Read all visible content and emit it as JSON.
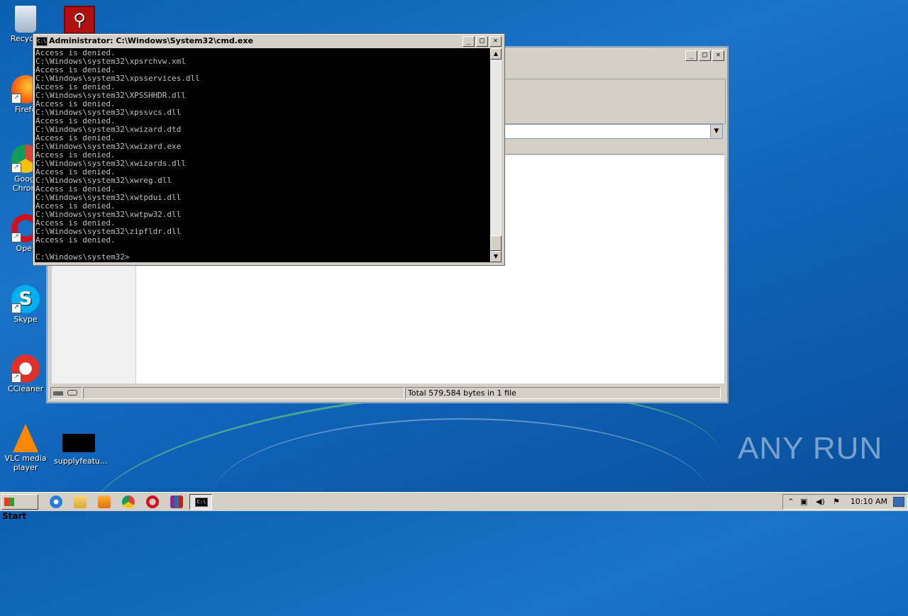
{
  "desktop": {
    "icons": [
      {
        "label": "Recycle",
        "icon": "recycle-bin-icon"
      },
      {
        "label": "Firefo",
        "icon": "firefox-icon"
      },
      {
        "label": "Googl",
        "label2": "Chrom",
        "icon": "chrome-icon"
      },
      {
        "label": "Oper",
        "icon": "opera-icon"
      },
      {
        "label": "Skype",
        "icon": "skype-icon"
      },
      {
        "label": "CCleaner",
        "icon": "ccleaner-icon"
      },
      {
        "label": "VLC media",
        "label2": "player",
        "icon": "vlc-icon"
      },
      {
        "label": "supplyfeatu...",
        "icon": "exe-file-icon"
      },
      {
        "label": "",
        "icon": "acrobat-icon"
      }
    ],
    "watermark": "ANY RUN"
  },
  "explorer": {
    "status_text": "Total 579,584 bytes in 1 file"
  },
  "cmd": {
    "title": "Administrator: C:\\Windows\\System32\\cmd.exe",
    "icon_text": "C:\\",
    "lines": [
      "Access is denied.",
      "C:\\Windows\\system32\\xpsrchvw.xml",
      "Access is denied.",
      "C:\\Windows\\system32\\xpsservices.dll",
      "Access is denied.",
      "C:\\Windows\\system32\\XPSSHHDR.dll",
      "Access is denied.",
      "C:\\Windows\\system32\\xpssvcs.dll",
      "Access is denied.",
      "C:\\Windows\\system32\\xwizard.dtd",
      "Access is denied.",
      "C:\\Windows\\system32\\xwizard.exe",
      "Access is denied.",
      "C:\\Windows\\system32\\xwizards.dll",
      "Access is denied.",
      "C:\\Windows\\system32\\xwreg.dll",
      "Access is denied.",
      "C:\\Windows\\system32\\xwtpdui.dll",
      "Access is denied.",
      "C:\\Windows\\system32\\xwtpw32.dll",
      "Access is denied.",
      "C:\\Windows\\system32\\zipfldr.dll",
      "Access is denied.",
      "",
      "C:\\Windows\\system32>"
    ]
  },
  "window_controls": {
    "minimize": "_",
    "maximize": "□",
    "close": "✕"
  },
  "taskbar": {
    "start_label": "Start",
    "quick_launch": [
      "ie-icon",
      "folder-icon",
      "media-player-icon",
      "chrome-icon",
      "opera-icon",
      "winrar-icon"
    ],
    "active_task": "cmd-task",
    "clock": "10:10 AM",
    "tray_icons": [
      "show-hidden-icon",
      "network-icon",
      "volume-icon",
      "action-center-flag-icon"
    ]
  },
  "colors": {
    "desktop_blue": "#1a74c8",
    "console_bg": "#000000",
    "console_fg": "#c0c0c0",
    "classic_gray": "#d4d0c8"
  }
}
